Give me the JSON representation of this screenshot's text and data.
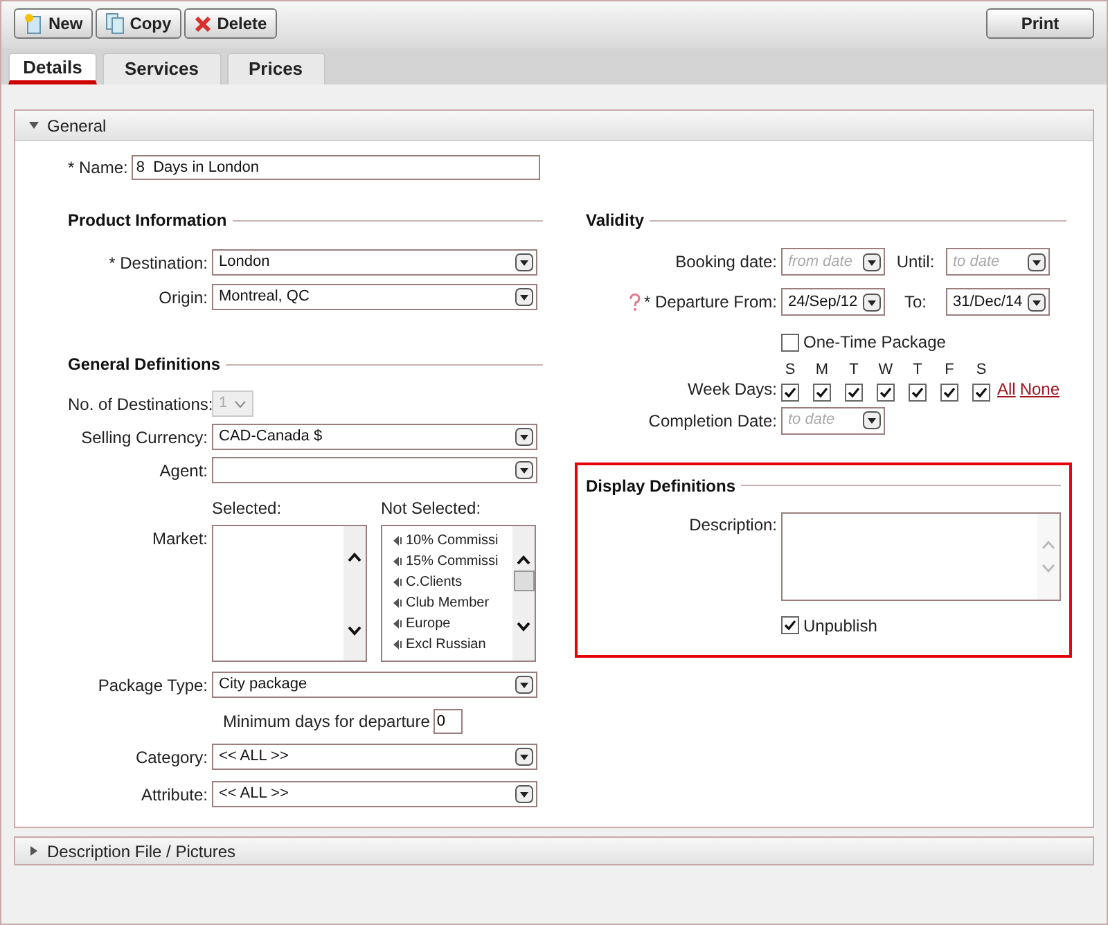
{
  "toolbar": {
    "buttons": [
      {
        "label": "New",
        "kind": "new"
      },
      {
        "label": "Copy",
        "kind": "copy"
      },
      {
        "label": "Delete",
        "kind": "delete"
      }
    ],
    "print": "Print"
  },
  "tabs": [
    {
      "label": "Details",
      "selected": true
    },
    {
      "label": "Services",
      "selected": false
    },
    {
      "label": "Prices",
      "selected": false
    }
  ],
  "general": {
    "title": "General",
    "expanded": true,
    "name": {
      "label": "* Name:",
      "value": "8  Days in London"
    }
  },
  "product_information": {
    "title": "Product Information",
    "fields": [
      {
        "label": "* Destination:",
        "value": "London"
      },
      {
        "label": "Origin:",
        "value": "Montreal, QC"
      }
    ]
  },
  "general_definitions": {
    "title": "General Definitions",
    "no_of_destinations": {
      "label": "No. of Destinations:",
      "value": "1",
      "disabled": true
    },
    "selling_currency": {
      "label": "Selling Currency:",
      "value": "CAD-Canada $"
    },
    "agent": {
      "label": "Agent:"
    },
    "market": {
      "label": "Market:",
      "selected_heading": "Selected:",
      "not_selected_heading": "Not Selected:",
      "not_selected_items": [
        "10% Commissi",
        "15% Commissi",
        "C.Clients",
        "Club Member",
        "Europe",
        "Excl Russian"
      ]
    },
    "package_type": {
      "label": "Package Type:",
      "value": "City package"
    },
    "min_days": {
      "label": "Minimum days for departure",
      "value": "0"
    },
    "category": {
      "label": "Category:",
      "value": "<< ALL >>"
    },
    "attribute": {
      "label": "Attribute:",
      "value": "<< ALL >>"
    }
  },
  "validity": {
    "title": "Validity",
    "booking": {
      "label": "Booking date:",
      "from": {
        "placeholder": "from date"
      },
      "until_label": "Until:",
      "until": {
        "placeholder": "to date"
      }
    },
    "departure": {
      "label": "* Departure From:",
      "from": {
        "value": "24/Sep/12"
      },
      "to_label": "To:",
      "to": {
        "value": "31/Dec/14"
      }
    },
    "one_time": {
      "label": "One-Time Package",
      "checked": false
    },
    "week_days": {
      "label": "Week Days:",
      "days": [
        {
          "letter": "S",
          "checked": true
        },
        {
          "letter": "M",
          "checked": true
        },
        {
          "letter": "T",
          "checked": true
        },
        {
          "letter": "W",
          "checked": true
        },
        {
          "letter": "T",
          "checked": true
        },
        {
          "letter": "F",
          "checked": true
        },
        {
          "letter": "S",
          "checked": true
        }
      ],
      "all_link": "All",
      "none_link": "None"
    },
    "completion": {
      "label": "Completion Date:",
      "field": {
        "placeholder": "to date"
      }
    }
  },
  "display_definitions": {
    "title": "Display Definitions",
    "highlighted": true,
    "description_label": "Description:",
    "unpublish": {
      "label": "Unpublish",
      "checked": true
    }
  },
  "description_file": {
    "title": "Description File / Pictures",
    "expanded": false
  }
}
